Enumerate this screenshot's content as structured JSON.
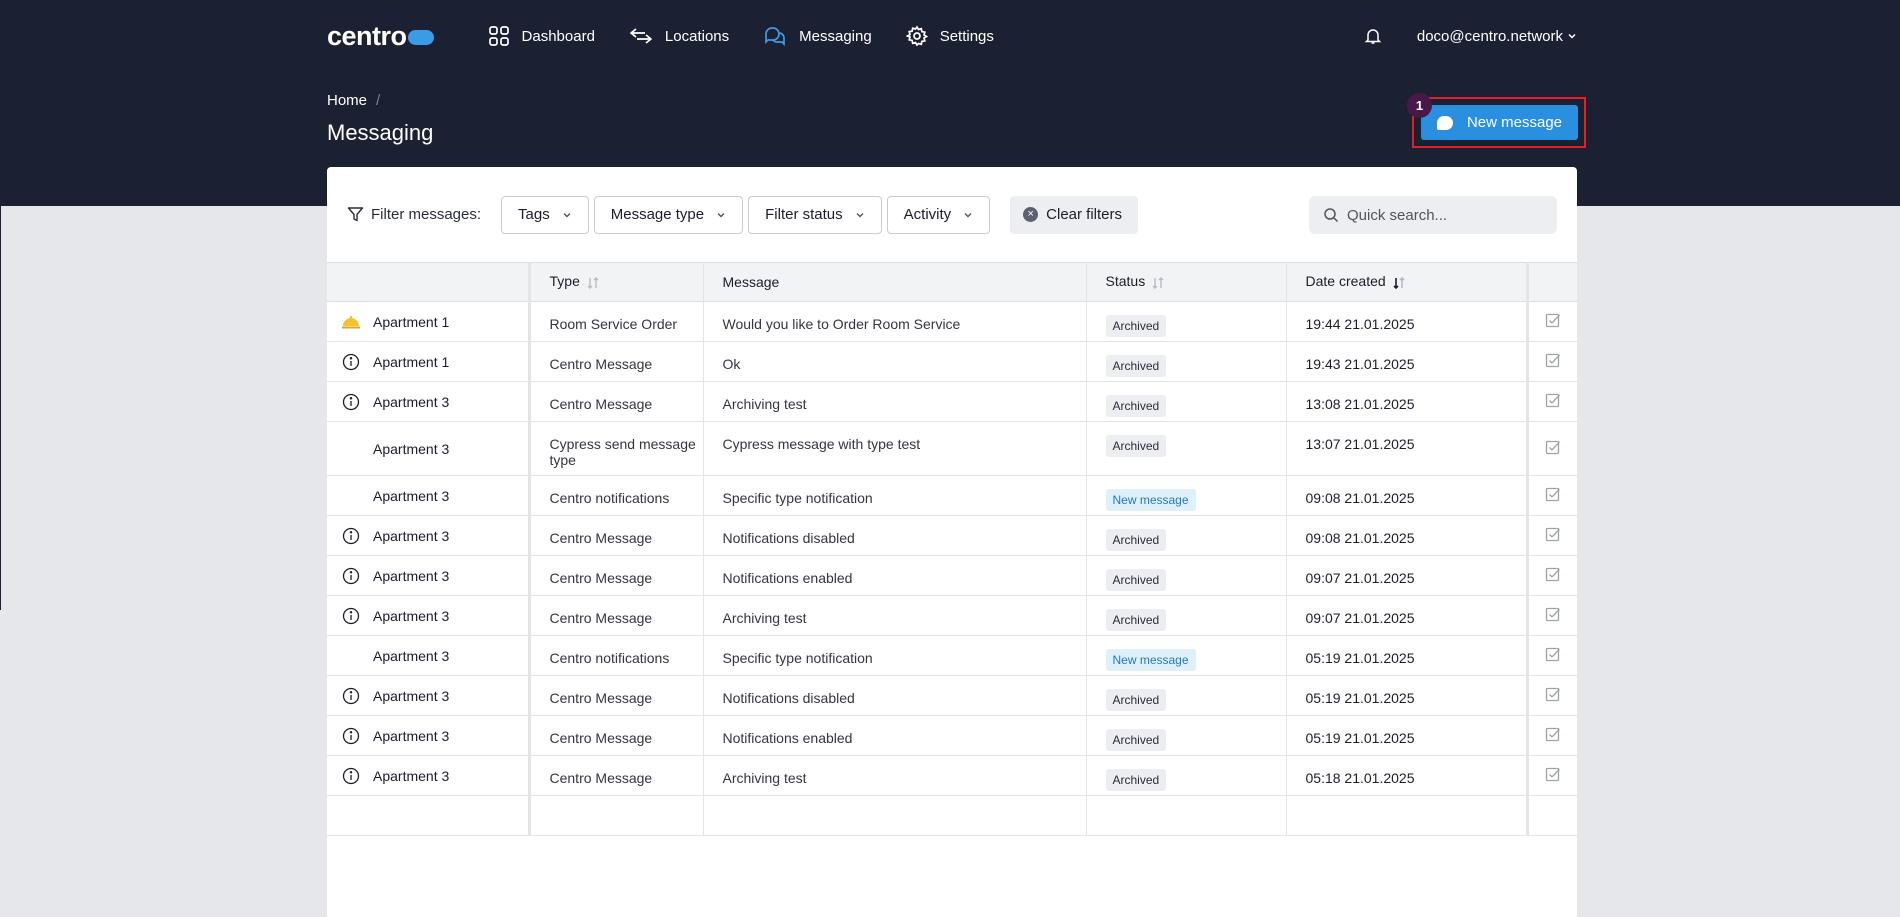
{
  "app": {
    "logo_text": "centro",
    "brand_color": "#3c9be6",
    "header_bg": "#1c2033"
  },
  "nav": {
    "items": [
      {
        "label": "Dashboard",
        "icon": "grid-icon"
      },
      {
        "label": "Locations",
        "icon": "arrows-icon"
      },
      {
        "label": "Messaging",
        "icon": "chat-icon",
        "active": true
      },
      {
        "label": "Settings",
        "icon": "gear-icon"
      }
    ],
    "user": "doco@centro.network"
  },
  "breadcrumb": {
    "home": "Home",
    "separator": "/"
  },
  "page": {
    "title": "Messaging"
  },
  "actions": {
    "new_message": "New message",
    "badge": "1"
  },
  "filters": {
    "label": "Filter messages:",
    "dropdowns": [
      "Tags",
      "Message type",
      "Filter status",
      "Activity"
    ],
    "clear": "Clear filters",
    "search_placeholder": "Quick search..."
  },
  "table": {
    "headers": [
      "",
      "Type",
      "Message",
      "Status",
      "Date created",
      ""
    ],
    "rows": [
      {
        "icon": "room-service-icon",
        "location": "Apartment 1",
        "type": "Room Service Order",
        "message": "Would you like to Order Room Service",
        "status": "Archived",
        "status_kind": "archived",
        "date": "19:44 21.01.2025"
      },
      {
        "icon": "info-icon",
        "location": "Apartment 1",
        "type": "Centro Message",
        "message": "Ok",
        "status": "Archived",
        "status_kind": "archived",
        "date": "19:43 21.01.2025"
      },
      {
        "icon": "info-icon",
        "location": "Apartment 3",
        "type": "Centro Message",
        "message": "Archiving test",
        "status": "Archived",
        "status_kind": "archived",
        "date": "13:08 21.01.2025"
      },
      {
        "icon": "",
        "location": "Apartment 3",
        "type": "Cypress send message type",
        "message": "Cypress message with type test",
        "status": "Archived",
        "status_kind": "archived",
        "date": "13:07 21.01.2025"
      },
      {
        "icon": "",
        "location": "Apartment 3",
        "type": "Centro notifications",
        "message": "Specific type notification",
        "status": "New message",
        "status_kind": "new",
        "date": "09:08 21.01.2025"
      },
      {
        "icon": "info-icon",
        "location": "Apartment 3",
        "type": "Centro Message",
        "message": "Notifications disabled",
        "status": "Archived",
        "status_kind": "archived",
        "date": "09:08 21.01.2025"
      },
      {
        "icon": "info-icon",
        "location": "Apartment 3",
        "type": "Centro Message",
        "message": "Notifications enabled",
        "status": "Archived",
        "status_kind": "archived",
        "date": "09:07 21.01.2025"
      },
      {
        "icon": "info-icon",
        "location": "Apartment 3",
        "type": "Centro Message",
        "message": "Archiving test",
        "status": "Archived",
        "status_kind": "archived",
        "date": "09:07 21.01.2025"
      },
      {
        "icon": "",
        "location": "Apartment 3",
        "type": "Centro notifications",
        "message": "Specific type notification",
        "status": "New message",
        "status_kind": "new",
        "date": "05:19 21.01.2025"
      },
      {
        "icon": "info-icon",
        "location": "Apartment 3",
        "type": "Centro Message",
        "message": "Notifications disabled",
        "status": "Archived",
        "status_kind": "archived",
        "date": "05:19 21.01.2025"
      },
      {
        "icon": "info-icon",
        "location": "Apartment 3",
        "type": "Centro Message",
        "message": "Notifications enabled",
        "status": "Archived",
        "status_kind": "archived",
        "date": "05:19 21.01.2025"
      },
      {
        "icon": "info-icon",
        "location": "Apartment 3",
        "type": "Centro Message",
        "message": "Archiving test",
        "status": "Archived",
        "status_kind": "archived",
        "date": "05:18 21.01.2025"
      },
      {
        "icon": "",
        "location": "",
        "type": "",
        "message": "",
        "status": "",
        "status_kind": "",
        "date": ""
      }
    ]
  }
}
